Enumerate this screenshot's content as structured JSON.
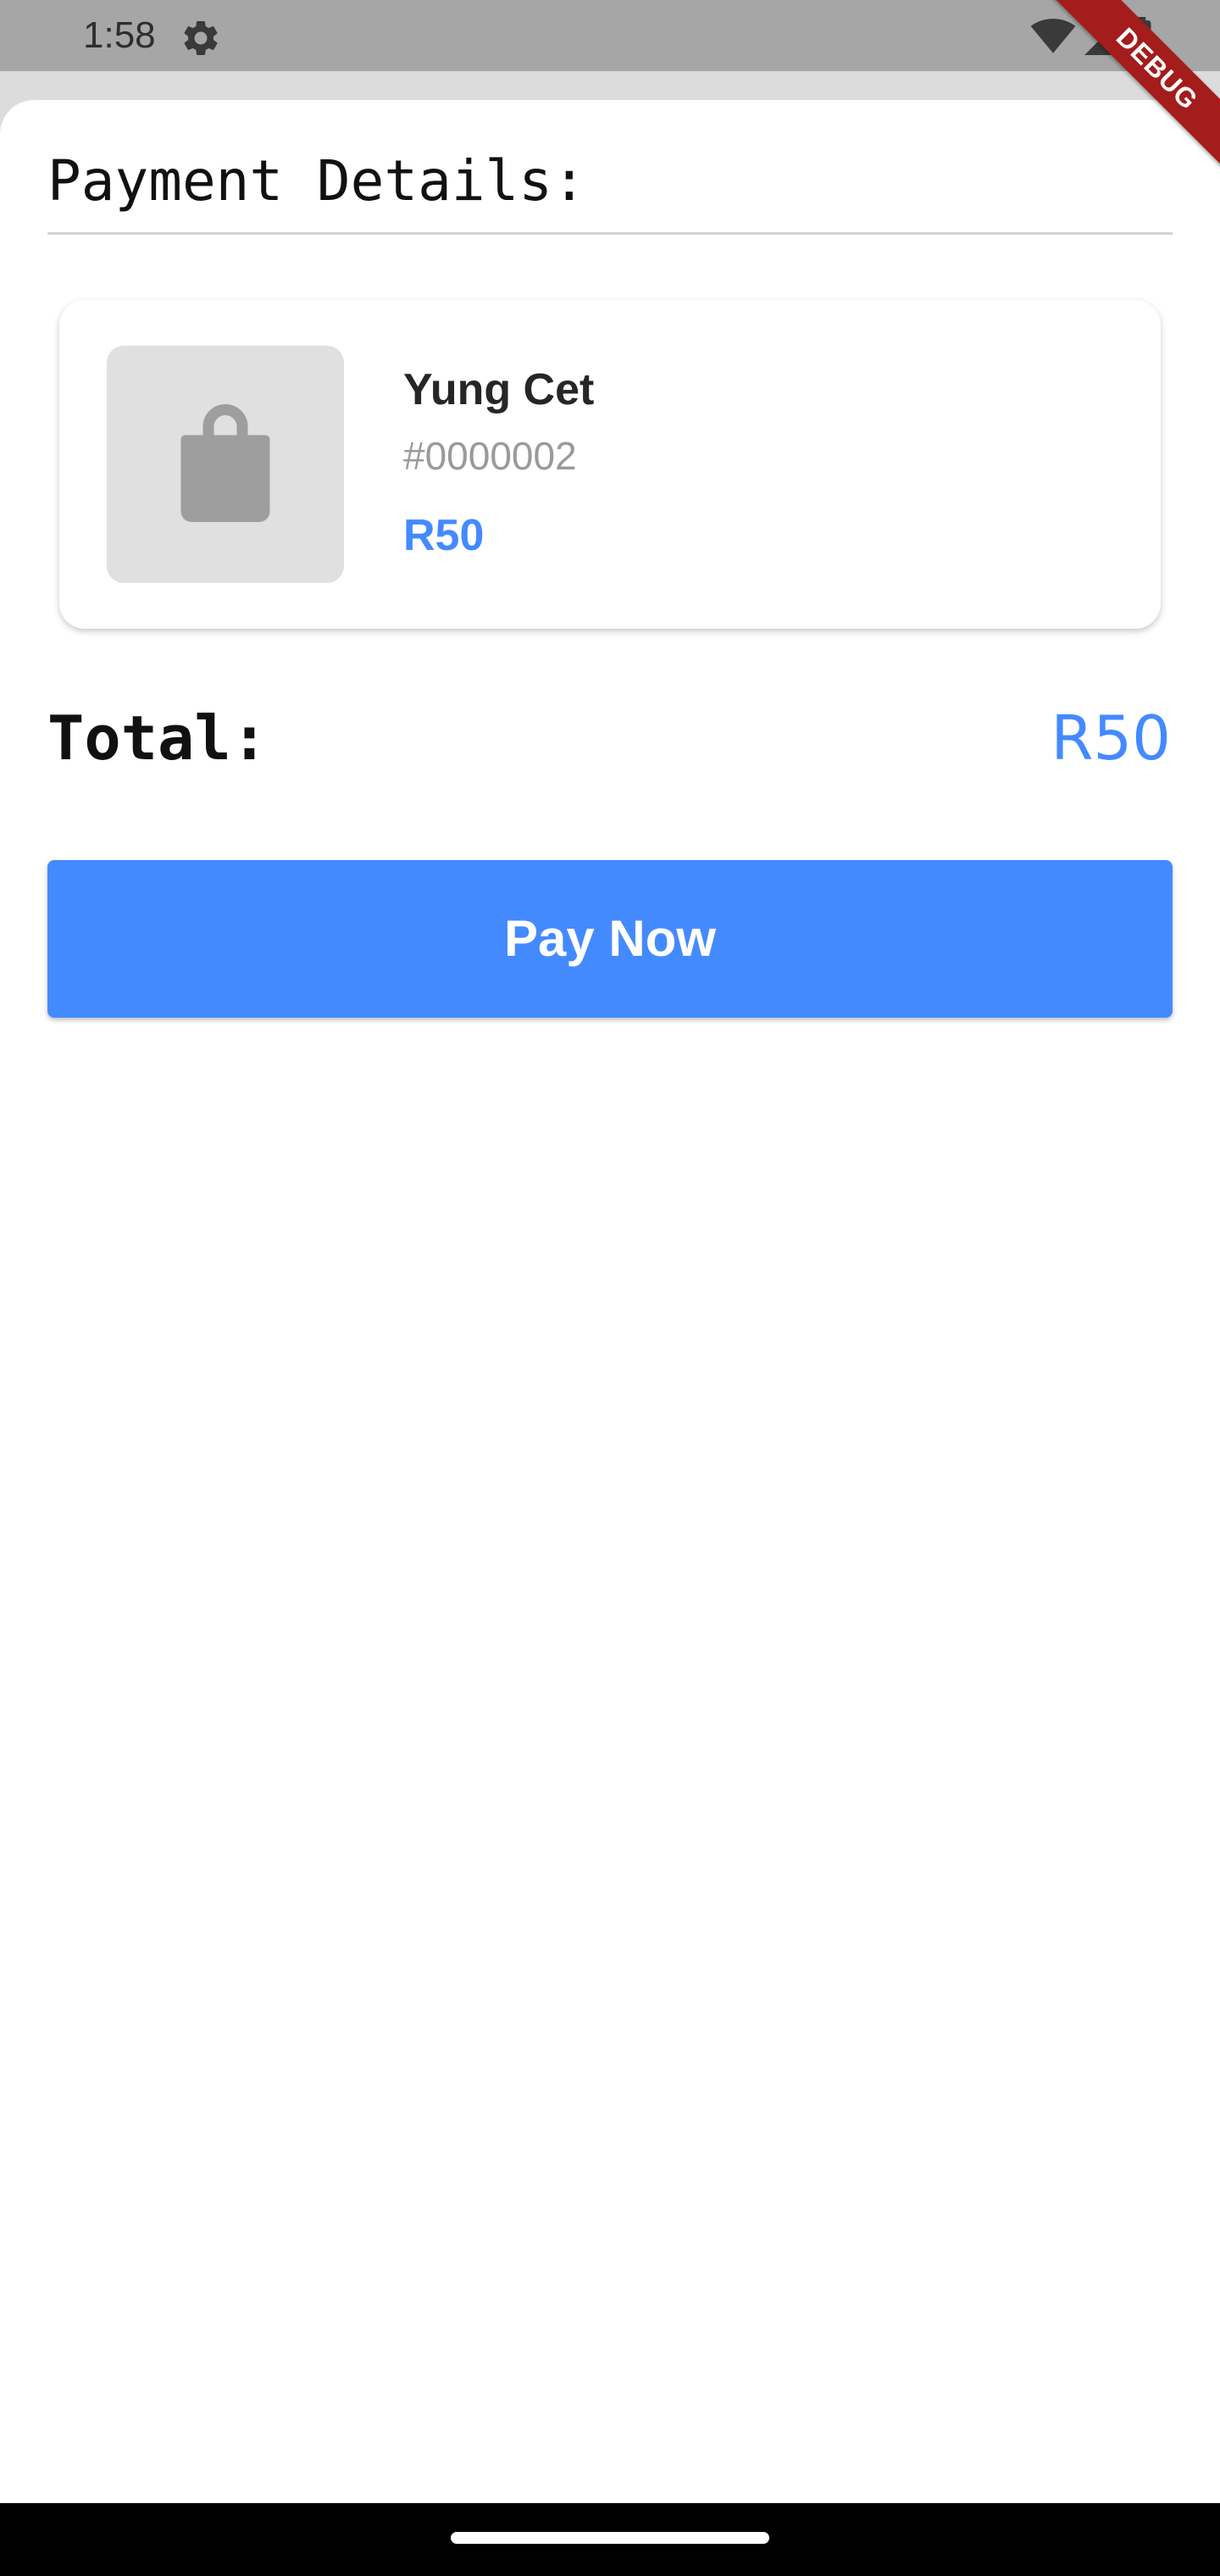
{
  "status_bar": {
    "time": "1:58",
    "icons": [
      "settings-gear-icon",
      "wifi-icon",
      "cell-signal-icon",
      "battery-icon"
    ]
  },
  "debug_banner": "DEBUG",
  "sheet": {
    "title": "Payment Details:"
  },
  "order_item": {
    "name": "Yung Cet",
    "id": "#0000002",
    "price": "R50",
    "thumbnail_icon": "shopping-bag-icon"
  },
  "total": {
    "label": "Total:",
    "value": "R50"
  },
  "actions": {
    "pay_label": "Pay Now"
  },
  "colors": {
    "accent": "#448aff",
    "status_bar": "#a6a6a6",
    "thumbnail_bg": "#e0e0e0",
    "debug_ribbon": "#a51c1c"
  }
}
